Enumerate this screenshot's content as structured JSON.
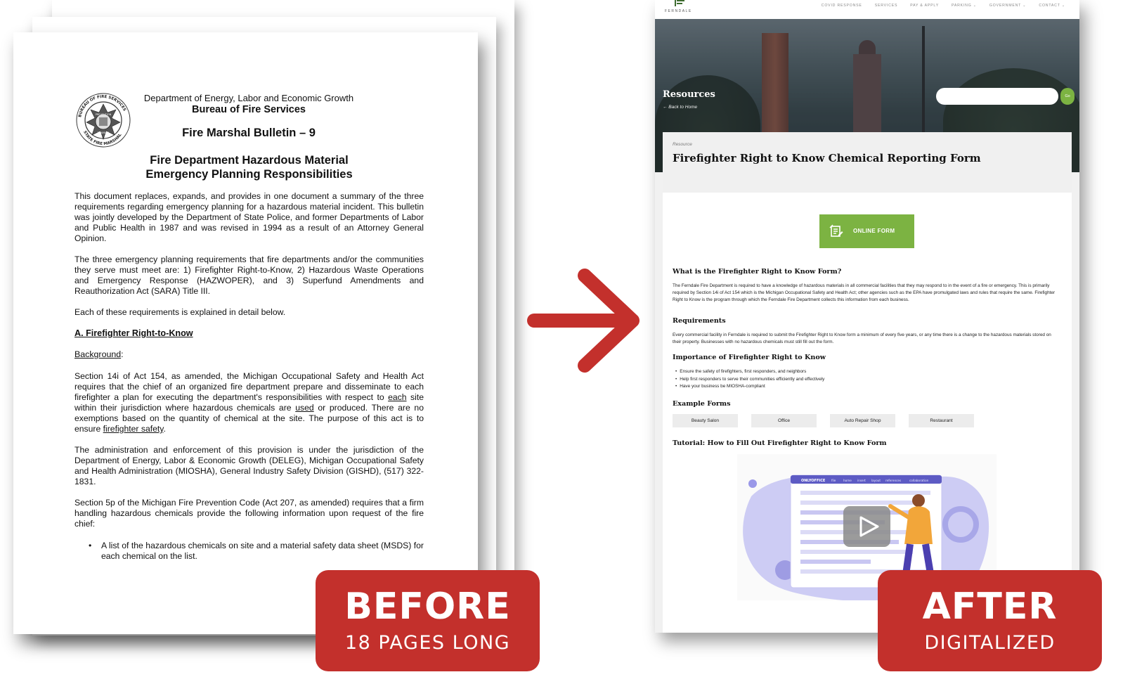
{
  "document": {
    "dept": "Department of Energy, Labor and Economic Growth",
    "bureau": "Bureau of Fire Services",
    "bulletin": "Fire Marshal Bulletin – 9",
    "title_line1": "Fire Department Hazardous Material",
    "title_line2": "Emergency Planning Responsibilities",
    "para1": "This document replaces, expands, and provides in one document a summary of the three requirements regarding emergency planning for a hazardous material incident. This bulletin was jointly developed by the Department of State Police, and former Departments of Labor and Public Health in 1987 and was revised in 1994 as a result of an Attorney General Opinion.",
    "para2": "The three emergency planning requirements that fire departments and/or the communities they serve must meet are: 1) Firefighter Right-to-Know, 2) Hazardous Waste Operations and Emergency Response (HAZWOPER), and 3) Superfund Amendments and Reauthorization Act (SARA) Title III.",
    "para3": "Each of these requirements is explained in detail below.",
    "section_a": "A. Firefighter Right-to-Know",
    "background": "Background",
    "para4_a": "Section 14i of Act 154, as amended, the Michigan Occupational Safety and Health Act requires that the chief of an organized fire department prepare and disseminate to each firefighter a plan for executing the department's responsibilities with respect to ",
    "para4_each": "each",
    "para4_b": " site within their jurisdiction where hazardous chemicals are ",
    "para4_used": "used",
    "para4_c": " or produced. There are no exemptions based on the quantity of chemical at the site. The purpose of this act is to ensure ",
    "para4_safety": "firefighter safety",
    "para4_d": ".",
    "para5": "The administration and enforcement of this provision is under the jurisdiction of the Department of Energy, Labor & Economic Growth (DELEG), Michigan Occupational Safety and Health Administration (MIOSHA), General Industry Safety Division (GISHD), (517) 322-1831.",
    "para6": "Section 5p of the Michigan Fire Prevention Code (Act 207, as amended) requires that a firm handling hazardous chemicals provide the following information upon request of the fire chief:",
    "bullet1": "A list of the hazardous chemicals on site and a material safety data sheet (MSDS) for each chemical on the list.",
    "seal_top": "BUREAU OF FIRE SERVICES",
    "seal_bottom": "STATE FIRE MARSHAL"
  },
  "site": {
    "logo_text": "FERNDALE",
    "nav": [
      "COVID RESPONSE",
      "SERVICES",
      "PAY & APPLY",
      "PARKING ⌄",
      "GOVERNMENT ⌄",
      "CONTACT ⌄"
    ],
    "hero_title": "Resources",
    "back_link": "← Back to Home",
    "search_go": "Go",
    "resource_label": "Resource",
    "page_title": "Firefighter Right to Know Chemical Reporting Form",
    "online_form": "ONLINE FORM",
    "h_what": "What is the Firefighter Right to Know Form?",
    "p_what": "The Ferndale Fire Department is required to have a knowledge of hazardous materials in all commercial facilities that they may respond to in the event of a fire or emergency. This is primarily required by Section 14i of Act 154 which is the Michigan Occupational Safety and Health Act; other agencies such as the EPA have promulgated laws and rules that require the same. Firefighter Right to Know is the program through which the Ferndale Fire Department collects this information from each business.",
    "h_req": "Requirements",
    "p_req": "Every commercial facility in Ferndale is required to submit the Firefighter Right to Know form a minimum of every five years, or any time there is a change to the hazardous materials stored on their property. Businesses with no hazardous chemicals must still fill out the form.",
    "h_importance": "Importance of Firefighter Right to Know",
    "importance": [
      "Ensure the safety of firefighters, first responders, and neighbors",
      "Help first responders to serve their communities efficiently and effectively",
      "Have your business be MIOSHA-compliant"
    ],
    "h_examples": "Example Forms",
    "examples": [
      "Beauty Salon",
      "Office",
      "Auto Repair Shop",
      "Restaurant"
    ],
    "h_tutorial": "Tutorial: How to Fill Out Firefighter Right to Know Form",
    "video_brand": "ONLYOFFICE",
    "video_menu": [
      "file",
      "home",
      "insert",
      "layout",
      "references",
      "collaboration"
    ]
  },
  "badges": {
    "before_big": "BEFORE",
    "before_small": "18 PAGES LONG",
    "after_big": "AFTER",
    "after_small": "DIGITALIZED"
  },
  "colors": {
    "badge_red": "#c3302c",
    "arrow_red": "#c3302c",
    "accent_green": "#7cb342"
  }
}
